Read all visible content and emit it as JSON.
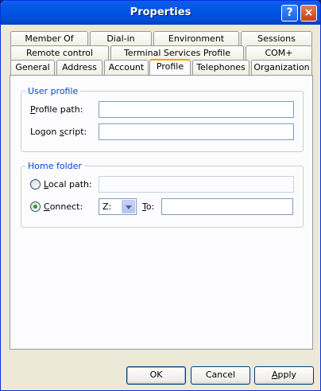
{
  "window": {
    "title": "Properties"
  },
  "titlebar_buttons": {
    "help": "?",
    "close": "×"
  },
  "tabs": {
    "row1": [
      "Member Of",
      "Dial-in",
      "Environment",
      "Sessions"
    ],
    "row2": [
      "Remote control",
      "Terminal Services Profile",
      "COM+"
    ],
    "row3": [
      "General",
      "Address",
      "Account",
      "Profile",
      "Telephones",
      "Organization"
    ],
    "active": "Profile"
  },
  "user_profile": {
    "legend": "User profile",
    "profile_path_label_u": "P",
    "profile_path_label_rest": "rofile path:",
    "profile_path_value": "",
    "logon_script_label_pre": "Logon ",
    "logon_script_label_u": "s",
    "logon_script_label_rest": "cript:",
    "logon_script_value": ""
  },
  "home_folder": {
    "legend": "Home folder",
    "local_path_label_u": "L",
    "local_path_label_rest": "ocal path:",
    "local_path_value": "",
    "connect_label_u": "C",
    "connect_label_rest": "onnect:",
    "selected": "connect",
    "drive": "Z:",
    "to_label_u": "T",
    "to_label_rest": "o:",
    "to_value": ""
  },
  "buttons": {
    "ok": "OK",
    "cancel": "Cancel",
    "apply_u": "A",
    "apply_rest": "pply"
  }
}
